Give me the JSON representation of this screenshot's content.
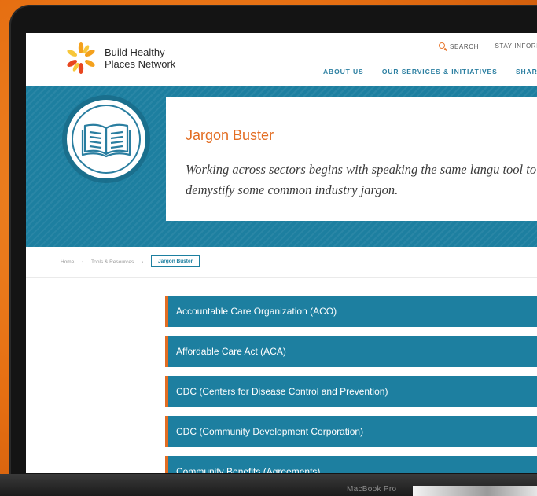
{
  "device": {
    "label": "MacBook Pro"
  },
  "header": {
    "brand_line1": "Build Healthy",
    "brand_line2": "Places Network",
    "utility": {
      "search_label": "SEARCH",
      "stay_label": "STAY INFORI"
    },
    "nav": [
      "ABOUT US",
      "OUR SERVICES & INITIATIVES",
      "SHARIN"
    ]
  },
  "hero": {
    "title": "Jargon Buster",
    "description": "Working across sectors begins with speaking the same langu tool to demystify some common industry jargon."
  },
  "breadcrumb": {
    "items": [
      "Home",
      "Tools & Resources"
    ],
    "current": "Jargon Buster"
  },
  "jargon_items": [
    "Accountable Care Organization (ACO)",
    "Affordable Care Act (ACA)",
    "CDC (Centers for Disease Control and Prevention)",
    "CDC (Community Development Corporation)",
    "Community Benefits (Agreements)"
  ],
  "colors": {
    "accent_orange": "#e36d22",
    "primary_blue": "#1d7fa0",
    "background_orange": "#e66f12"
  }
}
